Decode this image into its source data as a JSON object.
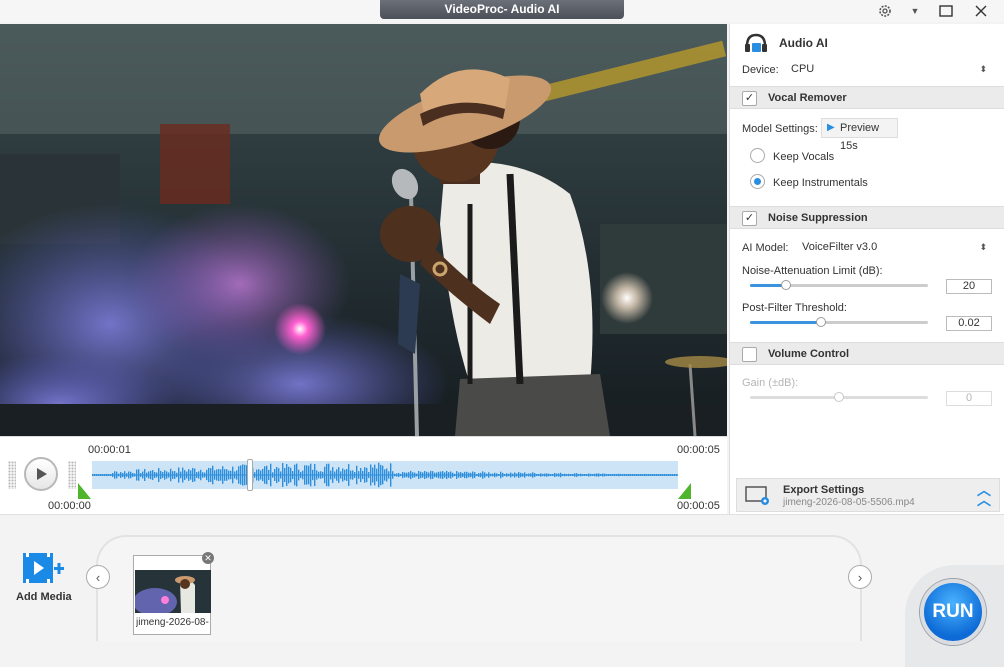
{
  "window": {
    "title": "VideoProc- Audio AI"
  },
  "timeline": {
    "current_time": "00:00:01",
    "end_time_top": "00:00:05",
    "start_time": "00:00:00",
    "end_time_bottom": "00:00:05",
    "playhead_fraction": 0.27
  },
  "panel": {
    "header": {
      "title": "Audio AI"
    },
    "device": {
      "label": "Device:",
      "value": "CPU"
    },
    "vocal_remover": {
      "title": "Vocal Remover",
      "checked": true,
      "model_settings_label": "Model Settings:",
      "preview_label": "Preview 15s",
      "options": [
        {
          "label": "Keep Vocals",
          "selected": false
        },
        {
          "label": "Keep Instrumentals",
          "selected": true
        }
      ]
    },
    "noise_suppression": {
      "title": "Noise Suppression",
      "checked": true,
      "ai_model_label": "AI Model:",
      "ai_model_value": "VoiceFilter v3.0",
      "attenuation_label": "Noise-Attenuation Limit (dB):",
      "attenuation_value": "20",
      "attenuation_fraction": 0.2,
      "postfilter_label": "Post-Filter Threshold:",
      "postfilter_value": "0.02",
      "postfilter_fraction": 0.4
    },
    "volume_control": {
      "title": "Volume Control",
      "checked": false,
      "gain_label": "Gain (±dB):",
      "gain_value": "0",
      "gain_fraction": 0.5
    },
    "export": {
      "title": "Export Settings",
      "filename": "jimeng-2026-08-05-5506.mp4"
    }
  },
  "media": {
    "add_label": "Add Media",
    "items": [
      {
        "name": "jimeng-2026-08-"
      }
    ]
  },
  "run_label": "RUN",
  "colors": {
    "accent": "#2a8ee0",
    "handle_green": "#4fb52d",
    "wave_blue": "#2d8fdc"
  }
}
